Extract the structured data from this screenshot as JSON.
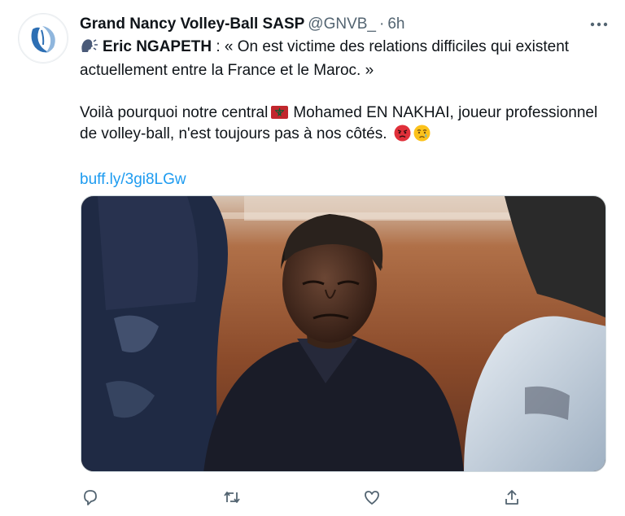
{
  "tweet": {
    "author_name": "Grand Nancy Volley-Ball SASP",
    "handle": "@GNVB_",
    "separator": "·",
    "time": "6h",
    "line1_name": "Eric NGAPETH",
    "line1_rest": " : « On est victime des relations difficiles qui existent actuellement entre la France et le Maroc. »",
    "line2_before_flag": "Voilà pourquoi notre central",
    "line2_after_flag": "Mohamed EN NAKHAI, joueur professionnel de volley-ball, n'est toujours pas à nos côtés.",
    "link": "buff.ly/3gi8LGw"
  },
  "icons": {
    "avatar": "gnvb-logo",
    "more": "more-icon",
    "speaker": "speaking-head-icon",
    "flag": "morocco-flag-icon",
    "angry": "angry-face-icon",
    "crying": "crying-face-icon",
    "reply": "reply-icon",
    "retweet": "retweet-icon",
    "like": "like-icon",
    "share": "share-icon"
  },
  "colors": {
    "text": "#0f1419",
    "secondary": "#536471",
    "link": "#1d9bf0",
    "logo_blue": "#2d6fb4"
  }
}
